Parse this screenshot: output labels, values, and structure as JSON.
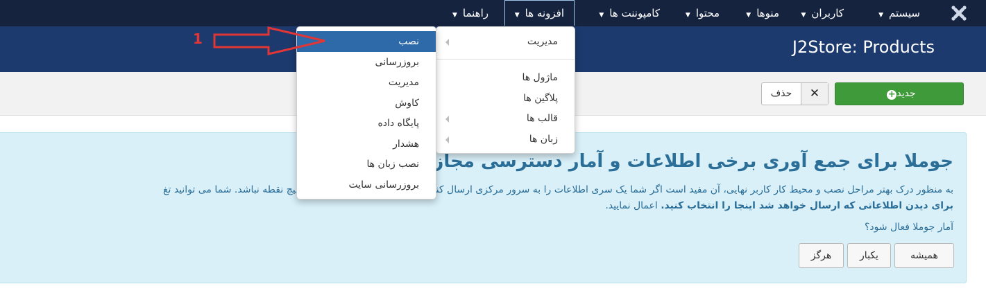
{
  "navbar": {
    "items": [
      {
        "label": "سیستم"
      },
      {
        "label": "کاربران"
      },
      {
        "label": "منوها"
      },
      {
        "label": "محتوا"
      },
      {
        "label": "کامپوننت ها"
      },
      {
        "label": "افزونه ها"
      },
      {
        "label": "راهنما"
      }
    ]
  },
  "header": {
    "title": "J2Store: Products"
  },
  "toolbar": {
    "new_label": "جدید",
    "delete_label": "حذف"
  },
  "extensions_menu": {
    "items": [
      {
        "label": "مدیریت",
        "has_submenu": true
      },
      {
        "label": "ماژول ها",
        "has_submenu": false
      },
      {
        "label": "پلاگین ها",
        "has_submenu": false
      },
      {
        "label": "قالب ها",
        "has_submenu": true
      },
      {
        "label": "زبان ها",
        "has_submenu": true
      }
    ]
  },
  "manage_submenu": {
    "items": [
      {
        "label": "نصب",
        "highlighted": true
      },
      {
        "label": "بروزرسانی"
      },
      {
        "label": "مدیریت"
      },
      {
        "label": "کاوش"
      },
      {
        "label": "پایگاه داده"
      },
      {
        "label": "هشدار"
      },
      {
        "label": "نصب زبان ها"
      },
      {
        "label": "بروزرسانی سایت"
      }
    ]
  },
  "stats_message": {
    "title": "جوملا برای جمع آوری برخی اطلاعات و آمار دسترسی مجاز",
    "body_line1": "به منظور درک بهتر مراحل نصب و محیط کار کاربر نهایی، آن مفید است اگر شما یک سری اطلاعات را به سرور مرکزی ارسال کنید. این داده شناسایی شده ای در هیچ نقطه نباشد. شما می توانید تغ",
    "body_line2": "اعمال نمایید.",
    "body_line3_bold": "برای دیدن اطلاعاتی که ارسال خواهد شد اینجا را انتخاب کنید.",
    "question": "آمار جوملا فعال شود؟",
    "buttons": {
      "always": "همیشه",
      "once": "یکبار",
      "never": "هرگز"
    }
  },
  "annotation": {
    "number": "1"
  },
  "colors": {
    "navbar": "#15233f",
    "header": "#1c3a6e",
    "success": "#3f9a3a",
    "highlight": "#2e6aa9",
    "info_text": "#2b6e98",
    "info_bg": "#d9f0f9",
    "annotation": "#e23636"
  }
}
